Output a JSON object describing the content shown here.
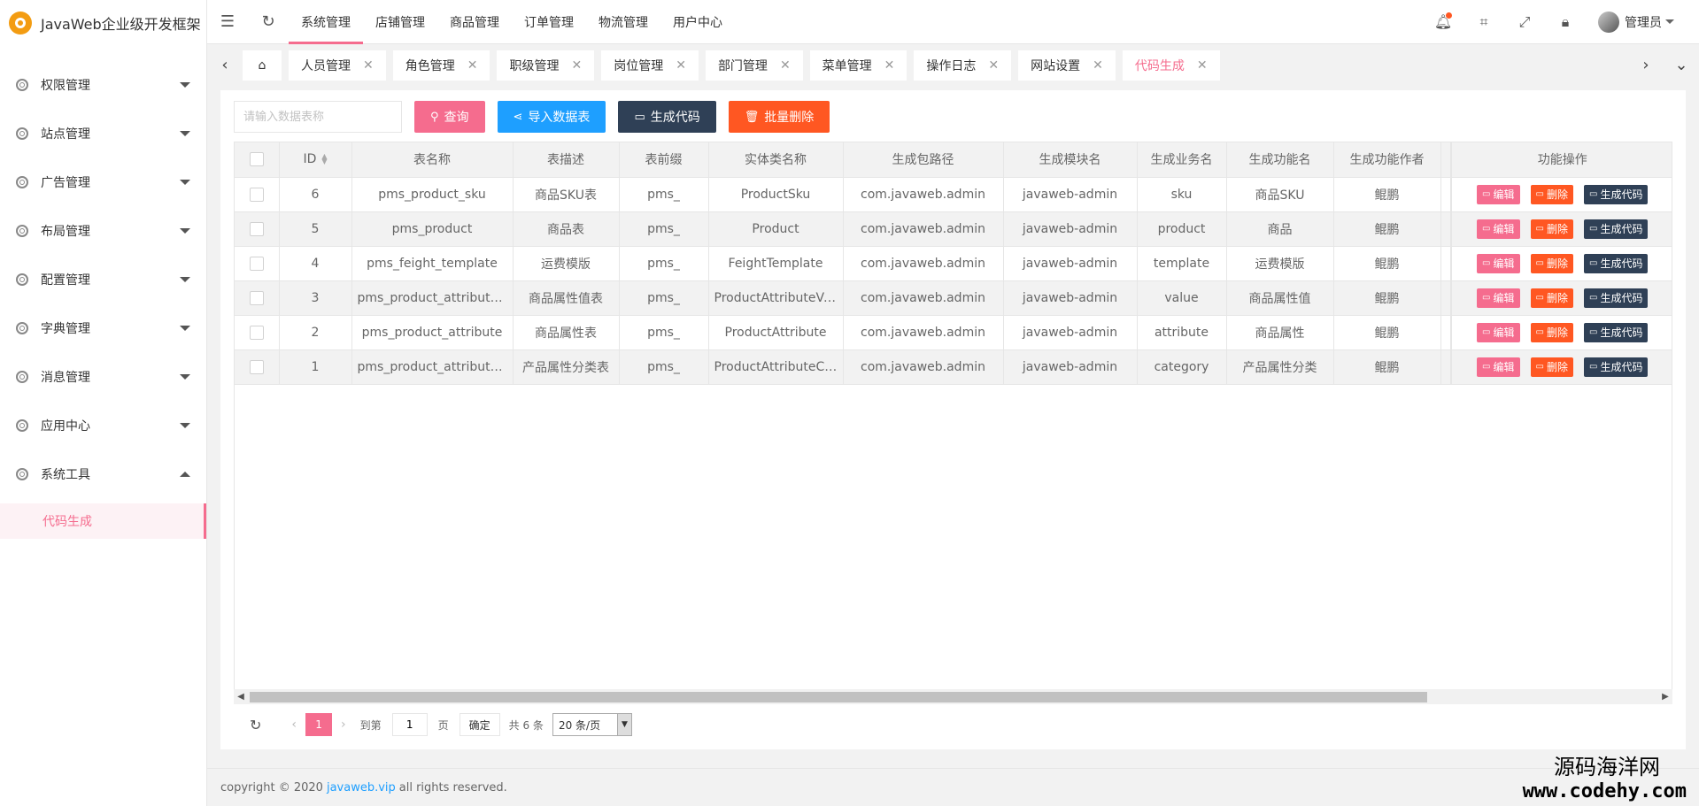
{
  "app": {
    "title": "JavaWeb企业级开发框架"
  },
  "sidebar": {
    "items": [
      {
        "label": "权限管理"
      },
      {
        "label": "站点管理"
      },
      {
        "label": "广告管理"
      },
      {
        "label": "布局管理"
      },
      {
        "label": "配置管理"
      },
      {
        "label": "字典管理"
      },
      {
        "label": "消息管理"
      },
      {
        "label": "应用中心"
      },
      {
        "label": "系统工具",
        "expanded": true
      }
    ],
    "subitem": {
      "label": "代码生成",
      "active": true
    }
  },
  "header": {
    "nav": [
      "系统管理",
      "店铺管理",
      "商品管理",
      "订单管理",
      "物流管理",
      "用户中心"
    ],
    "active_nav": "系统管理",
    "user": "管理员",
    "icons": [
      "bell-icon",
      "tag-icon",
      "fullscreen-icon",
      "lock-icon"
    ]
  },
  "tabs": {
    "items": [
      "人员管理",
      "角色管理",
      "职级管理",
      "岗位管理",
      "部门管理",
      "菜单管理",
      "操作日志",
      "网站设置",
      "代码生成"
    ],
    "active": "代码生成"
  },
  "toolbar": {
    "search_placeholder": "请输入数据表称",
    "query": "查询",
    "import": "导入数据表",
    "generate": "生成代码",
    "batch_delete": "批量删除"
  },
  "table": {
    "columns": [
      "ID",
      "表名称",
      "表描述",
      "表前缀",
      "实体类名称",
      "生成包路径",
      "生成模块名",
      "生成业务名",
      "生成功能名",
      "生成功能作者",
      "功能操作"
    ],
    "rows": [
      [
        "6",
        "pms_product_sku",
        "商品SKU表",
        "pms_",
        "ProductSku",
        "com.javaweb.admin",
        "javaweb-admin",
        "sku",
        "商品SKU",
        "鲲鹏"
      ],
      [
        "5",
        "pms_product",
        "商品表",
        "pms_",
        "Product",
        "com.javaweb.admin",
        "javaweb-admin",
        "product",
        "商品",
        "鲲鹏"
      ],
      [
        "4",
        "pms_feight_template",
        "运费模版",
        "pms_",
        "FeightTemplate",
        "com.javaweb.admin",
        "javaweb-admin",
        "template",
        "运费模版",
        "鲲鹏"
      ],
      [
        "3",
        "pms_product_attribute_value",
        "商品属性值表",
        "pms_",
        "ProductAttributeValue",
        "com.javaweb.admin",
        "javaweb-admin",
        "value",
        "商品属性值",
        "鲲鹏"
      ],
      [
        "2",
        "pms_product_attribute",
        "商品属性表",
        "pms_",
        "ProductAttribute",
        "com.javaweb.admin",
        "javaweb-admin",
        "attribute",
        "商品属性",
        "鲲鹏"
      ],
      [
        "1",
        "pms_product_attribute_category",
        "产品属性分类表",
        "pms_",
        "ProductAttributeCategory",
        "com.javaweb.admin",
        "javaweb-admin",
        "category",
        "产品属性分类",
        "鲲鹏"
      ]
    ],
    "actions": {
      "edit": "编辑",
      "delete": "删除",
      "generate": "生成代码"
    }
  },
  "pager": {
    "current": "1",
    "goto_label": "到第",
    "page_value": "1",
    "page_unit": "页",
    "confirm": "确定",
    "total": "共 6 条",
    "page_size": "20 条/页"
  },
  "footer": {
    "prefix": "copyright © 2020",
    "link": "javaweb.vip",
    "suffix": "all rights reserved."
  },
  "watermark": {
    "cn": "源码海洋网",
    "url": "www.codehy.com"
  },
  "colors": {
    "accent": "#f56c8e",
    "blue": "#1e9fff",
    "dark": "#2f4056",
    "red": "#ff5722"
  }
}
